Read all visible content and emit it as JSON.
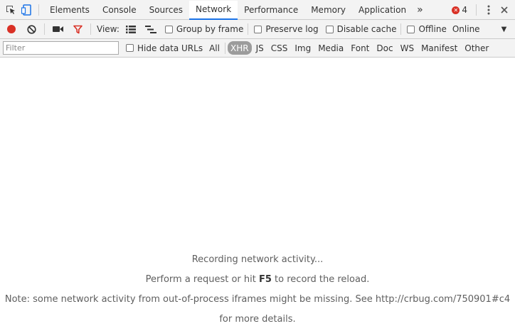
{
  "tabs": [
    {
      "label": "Elements"
    },
    {
      "label": "Console"
    },
    {
      "label": "Sources"
    },
    {
      "label": "Network"
    },
    {
      "label": "Performance"
    },
    {
      "label": "Memory"
    },
    {
      "label": "Application"
    }
  ],
  "active_tab": "Network",
  "more_tabs": "»",
  "error_count": "4",
  "toolbar": {
    "view_label": "View:",
    "group_by_frame": "Group by frame",
    "preserve_log": "Preserve log",
    "disable_cache": "Disable cache",
    "offline": "Offline",
    "throttling": "Online"
  },
  "filterbar": {
    "placeholder": "Filter",
    "hide_data_urls": "Hide data URLs",
    "types": [
      {
        "label": "All"
      },
      {
        "label": "XHR"
      },
      {
        "label": "JS"
      },
      {
        "label": "CSS"
      },
      {
        "label": "Img"
      },
      {
        "label": "Media"
      },
      {
        "label": "Font"
      },
      {
        "label": "Doc"
      },
      {
        "label": "WS"
      },
      {
        "label": "Manifest"
      },
      {
        "label": "Other"
      }
    ],
    "active_type": "XHR"
  },
  "empty_state": {
    "line1": "Recording network activity...",
    "line2_before": "Perform a request or hit ",
    "line2_key": "F5",
    "line2_after": " to record the reload.",
    "line3": "Note: some network activity from out-of-process iframes might be missing. See http://crbug.com/750901#c4",
    "line4": "for more details."
  },
  "colors": {
    "record": "#d93025",
    "filter_icon": "#d93025",
    "active_tab_underline": "#1a73e8",
    "active_type_bg": "#9c9c9c"
  }
}
